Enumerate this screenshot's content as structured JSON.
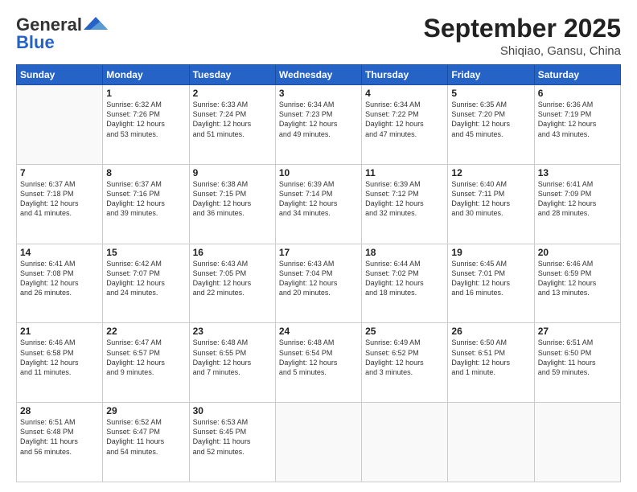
{
  "header": {
    "logo_general": "General",
    "logo_blue": "Blue",
    "month": "September 2025",
    "location": "Shiqiao, Gansu, China"
  },
  "days_of_week": [
    "Sunday",
    "Monday",
    "Tuesday",
    "Wednesday",
    "Thursday",
    "Friday",
    "Saturday"
  ],
  "weeks": [
    [
      {
        "day": "",
        "info": ""
      },
      {
        "day": "1",
        "info": "Sunrise: 6:32 AM\nSunset: 7:26 PM\nDaylight: 12 hours\nand 53 minutes."
      },
      {
        "day": "2",
        "info": "Sunrise: 6:33 AM\nSunset: 7:24 PM\nDaylight: 12 hours\nand 51 minutes."
      },
      {
        "day": "3",
        "info": "Sunrise: 6:34 AM\nSunset: 7:23 PM\nDaylight: 12 hours\nand 49 minutes."
      },
      {
        "day": "4",
        "info": "Sunrise: 6:34 AM\nSunset: 7:22 PM\nDaylight: 12 hours\nand 47 minutes."
      },
      {
        "day": "5",
        "info": "Sunrise: 6:35 AM\nSunset: 7:20 PM\nDaylight: 12 hours\nand 45 minutes."
      },
      {
        "day": "6",
        "info": "Sunrise: 6:36 AM\nSunset: 7:19 PM\nDaylight: 12 hours\nand 43 minutes."
      }
    ],
    [
      {
        "day": "7",
        "info": "Sunrise: 6:37 AM\nSunset: 7:18 PM\nDaylight: 12 hours\nand 41 minutes."
      },
      {
        "day": "8",
        "info": "Sunrise: 6:37 AM\nSunset: 7:16 PM\nDaylight: 12 hours\nand 39 minutes."
      },
      {
        "day": "9",
        "info": "Sunrise: 6:38 AM\nSunset: 7:15 PM\nDaylight: 12 hours\nand 36 minutes."
      },
      {
        "day": "10",
        "info": "Sunrise: 6:39 AM\nSunset: 7:14 PM\nDaylight: 12 hours\nand 34 minutes."
      },
      {
        "day": "11",
        "info": "Sunrise: 6:39 AM\nSunset: 7:12 PM\nDaylight: 12 hours\nand 32 minutes."
      },
      {
        "day": "12",
        "info": "Sunrise: 6:40 AM\nSunset: 7:11 PM\nDaylight: 12 hours\nand 30 minutes."
      },
      {
        "day": "13",
        "info": "Sunrise: 6:41 AM\nSunset: 7:09 PM\nDaylight: 12 hours\nand 28 minutes."
      }
    ],
    [
      {
        "day": "14",
        "info": "Sunrise: 6:41 AM\nSunset: 7:08 PM\nDaylight: 12 hours\nand 26 minutes."
      },
      {
        "day": "15",
        "info": "Sunrise: 6:42 AM\nSunset: 7:07 PM\nDaylight: 12 hours\nand 24 minutes."
      },
      {
        "day": "16",
        "info": "Sunrise: 6:43 AM\nSunset: 7:05 PM\nDaylight: 12 hours\nand 22 minutes."
      },
      {
        "day": "17",
        "info": "Sunrise: 6:43 AM\nSunset: 7:04 PM\nDaylight: 12 hours\nand 20 minutes."
      },
      {
        "day": "18",
        "info": "Sunrise: 6:44 AM\nSunset: 7:02 PM\nDaylight: 12 hours\nand 18 minutes."
      },
      {
        "day": "19",
        "info": "Sunrise: 6:45 AM\nSunset: 7:01 PM\nDaylight: 12 hours\nand 16 minutes."
      },
      {
        "day": "20",
        "info": "Sunrise: 6:46 AM\nSunset: 6:59 PM\nDaylight: 12 hours\nand 13 minutes."
      }
    ],
    [
      {
        "day": "21",
        "info": "Sunrise: 6:46 AM\nSunset: 6:58 PM\nDaylight: 12 hours\nand 11 minutes."
      },
      {
        "day": "22",
        "info": "Sunrise: 6:47 AM\nSunset: 6:57 PM\nDaylight: 12 hours\nand 9 minutes."
      },
      {
        "day": "23",
        "info": "Sunrise: 6:48 AM\nSunset: 6:55 PM\nDaylight: 12 hours\nand 7 minutes."
      },
      {
        "day": "24",
        "info": "Sunrise: 6:48 AM\nSunset: 6:54 PM\nDaylight: 12 hours\nand 5 minutes."
      },
      {
        "day": "25",
        "info": "Sunrise: 6:49 AM\nSunset: 6:52 PM\nDaylight: 12 hours\nand 3 minutes."
      },
      {
        "day": "26",
        "info": "Sunrise: 6:50 AM\nSunset: 6:51 PM\nDaylight: 12 hours\nand 1 minute."
      },
      {
        "day": "27",
        "info": "Sunrise: 6:51 AM\nSunset: 6:50 PM\nDaylight: 11 hours\nand 59 minutes."
      }
    ],
    [
      {
        "day": "28",
        "info": "Sunrise: 6:51 AM\nSunset: 6:48 PM\nDaylight: 11 hours\nand 56 minutes."
      },
      {
        "day": "29",
        "info": "Sunrise: 6:52 AM\nSunset: 6:47 PM\nDaylight: 11 hours\nand 54 minutes."
      },
      {
        "day": "30",
        "info": "Sunrise: 6:53 AM\nSunset: 6:45 PM\nDaylight: 11 hours\nand 52 minutes."
      },
      {
        "day": "",
        "info": ""
      },
      {
        "day": "",
        "info": ""
      },
      {
        "day": "",
        "info": ""
      },
      {
        "day": "",
        "info": ""
      }
    ]
  ]
}
